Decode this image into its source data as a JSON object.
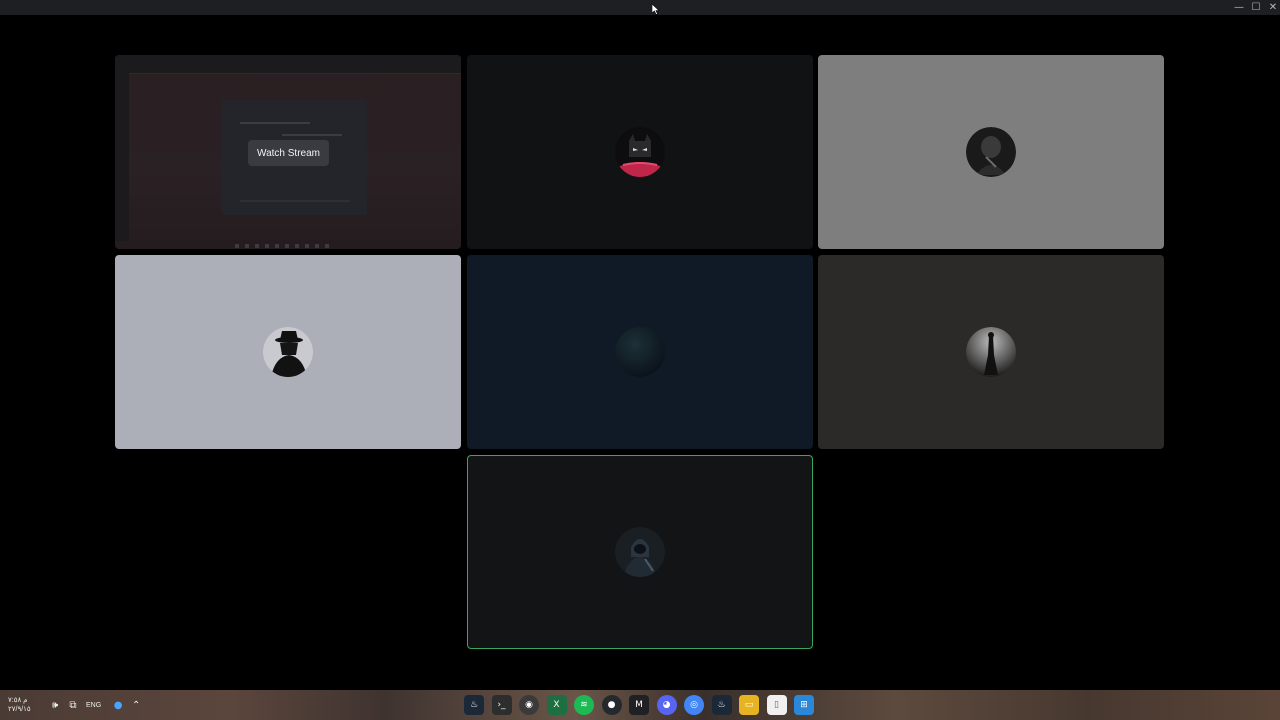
{
  "window": {
    "minimize_glyph": "—",
    "maximize_glyph": "☐",
    "close_glyph": "✕"
  },
  "tiles": [
    {
      "kind": "stream",
      "button_label": "Watch Stream",
      "bg": "#2a1f22"
    },
    {
      "kind": "avatar",
      "bg": "#111214",
      "avatar": "batman-avatar"
    },
    {
      "kind": "avatar",
      "bg": "#7e7e7e",
      "avatar": "dark-portrait-avatar"
    },
    {
      "kind": "avatar",
      "bg": "#adafb8",
      "avatar": "fedora-silhouette-avatar"
    },
    {
      "kind": "avatar",
      "bg": "#0f1a26",
      "avatar": "dark-orb-avatar"
    },
    {
      "kind": "avatar",
      "bg": "#2b2a28",
      "avatar": "figure-silhouette-avatar"
    },
    {
      "kind": "avatar",
      "bg": "#121415",
      "avatar": "hooded-figure-avatar",
      "speaking": true,
      "speaking_color": "#3ba55d"
    }
  ],
  "taskbar": {
    "clock_time": "م ٧:٥٨",
    "clock_date": "٢٧/٩/١٥",
    "language": "ENG",
    "tray_icons": [
      "speaker-icon",
      "network-icon",
      "microphone-icon",
      "chevron-up-icon"
    ],
    "apps": [
      {
        "name": "steam-icon",
        "color": "#1b2838"
      },
      {
        "name": "terminal-icon",
        "color": "#2d2d2d"
      },
      {
        "name": "obs-icon",
        "color": "#3a3a3a"
      },
      {
        "name": "excel-icon",
        "color": "#1d6f42"
      },
      {
        "name": "spotify-icon",
        "color": "#1db954"
      },
      {
        "name": "github-icon",
        "color": "#24292e"
      },
      {
        "name": "gmail-icon",
        "color": "#202124"
      },
      {
        "name": "discord-icon",
        "color": "#5865f2"
      },
      {
        "name": "chrome-icon",
        "color": "#4285f4"
      },
      {
        "name": "steam-alt-icon",
        "color": "#1b2838"
      },
      {
        "name": "file-explorer-icon",
        "color": "#e6b422"
      },
      {
        "name": "document-icon",
        "color": "#f0f0f0"
      },
      {
        "name": "windows-start-icon",
        "color": "#2b88d8"
      }
    ]
  }
}
